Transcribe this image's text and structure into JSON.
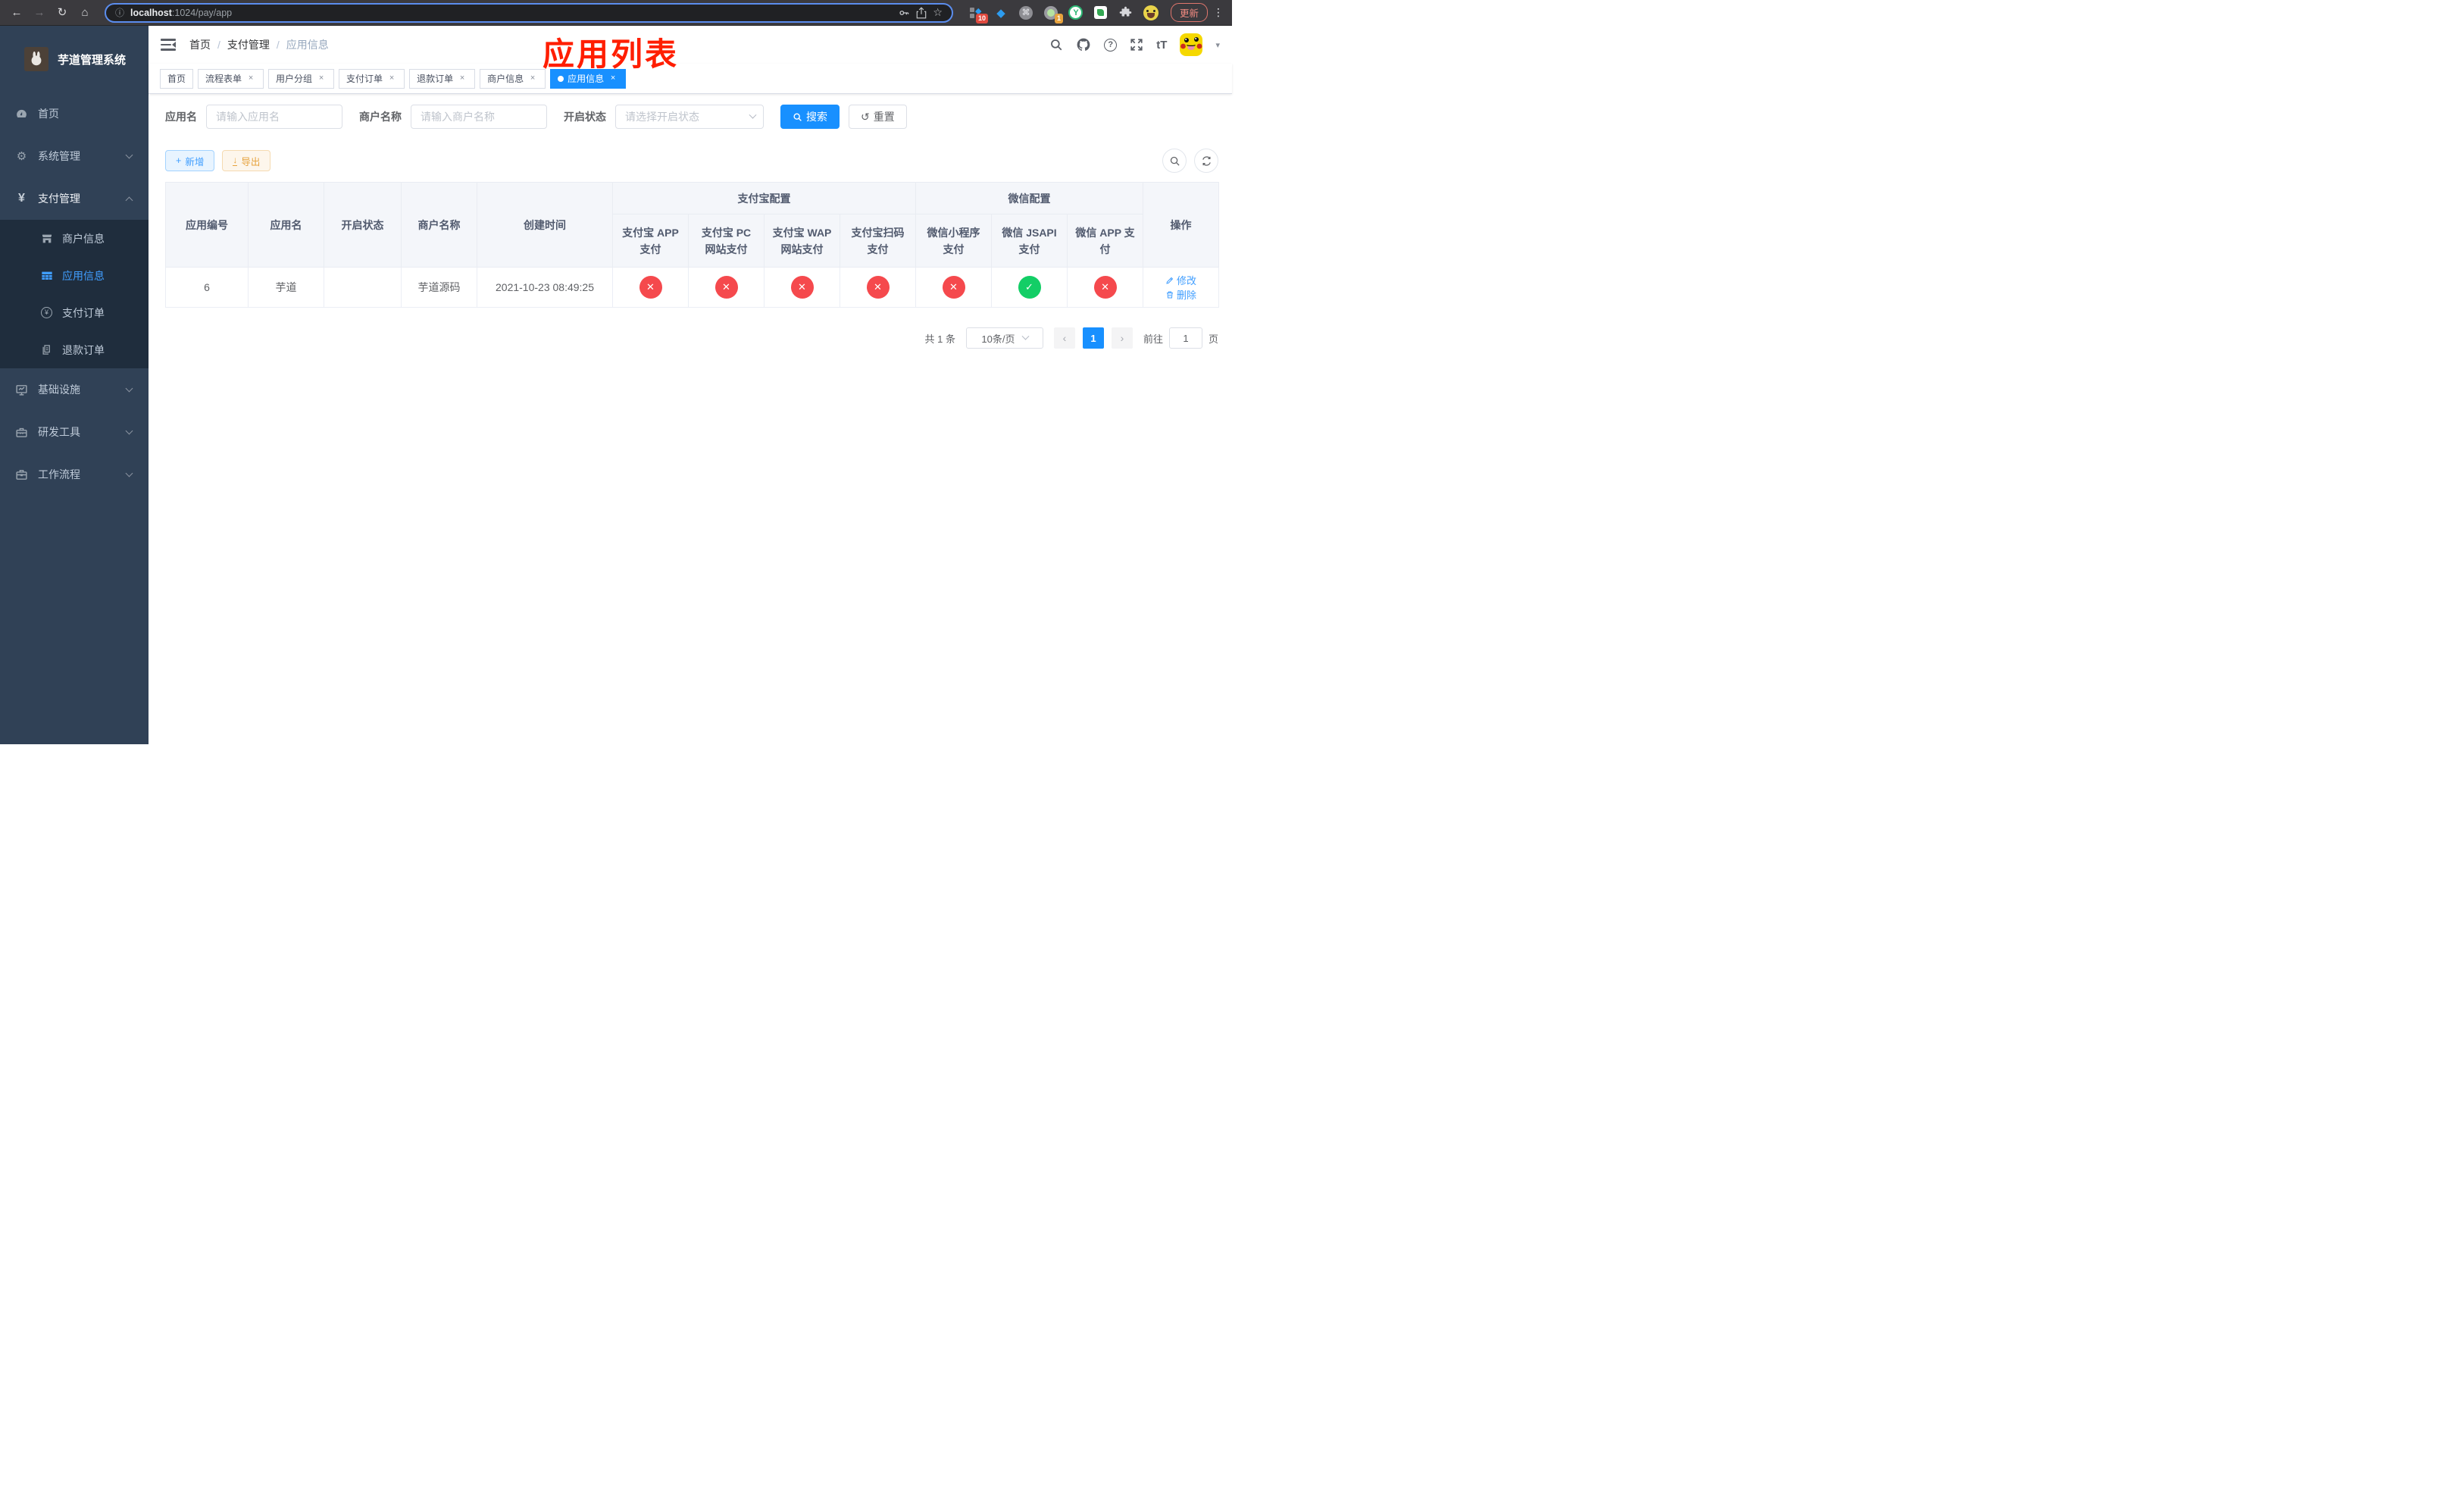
{
  "browser": {
    "url_host": "localhost",
    "url_path": ":1024/pay/app",
    "update_label": "更新",
    "ext_badge_tiles": "10",
    "ext_badge_record": "1",
    "ext_y_label": "Y"
  },
  "icons": {
    "back": "←",
    "forward": "→",
    "reload": "↻",
    "home": "⌂",
    "info": "ⓘ",
    "star": "☆",
    "command": "⌘",
    "pin": "◆",
    "diamond": "◆",
    "kebab": "⋮",
    "caret_down": "▾",
    "close": "×",
    "plus": "+",
    "download": "↓",
    "gear": "⚙",
    "yen": "¥",
    "coin_yen": "¥",
    "question": "?",
    "font_size": "tT",
    "check": "✓",
    "cross": "✕",
    "prev": "‹",
    "next": "›",
    "reset": "↺",
    "separator": "/"
  },
  "sidebar": {
    "title": "芋道管理系统",
    "menu_top": [
      {
        "label": "首页"
      },
      {
        "label": "系统管理"
      },
      {
        "label": "支付管理"
      }
    ],
    "submenu": [
      {
        "label": "商户信息"
      },
      {
        "label": "应用信息",
        "active": true
      },
      {
        "label": "支付订单"
      },
      {
        "label": "退款订单"
      }
    ],
    "menu_bottom": [
      {
        "label": "基础设施"
      },
      {
        "label": "研发工具"
      },
      {
        "label": "工作流程"
      }
    ]
  },
  "navbar": {
    "breadcrumb": [
      "首页",
      "支付管理",
      "应用信息"
    ]
  },
  "annotation": {
    "text": "应用列表"
  },
  "tabs": [
    {
      "label": "首页",
      "closable": false
    },
    {
      "label": "流程表单",
      "closable": true
    },
    {
      "label": "用户分组",
      "closable": true
    },
    {
      "label": "支付订单",
      "closable": true
    },
    {
      "label": "退款订单",
      "closable": true
    },
    {
      "label": "商户信息",
      "closable": true
    },
    {
      "label": "应用信息",
      "closable": true,
      "active": true
    }
  ],
  "filters": {
    "name_label": "应用名",
    "name_placeholder": "请输入应用名",
    "merchant_label": "商户名称",
    "merchant_placeholder": "请输入商户名称",
    "status_label": "开启状态",
    "status_placeholder": "请选择开启状态",
    "search_label": "搜索",
    "reset_label": "重置"
  },
  "toolbar": {
    "add_label": "新增",
    "export_label": "导出"
  },
  "table": {
    "fixed_columns": [
      "应用编号",
      "应用名",
      "开启状态",
      "商户名称",
      "创建时间"
    ],
    "groups": [
      {
        "label": "支付宝配置"
      },
      {
        "label": "微信配置"
      }
    ],
    "alipay_columns": [
      "支付宝 APP 支付",
      "支付宝 PC 网站支付",
      "支付宝 WAP 网站支付",
      "支付宝扫码支付"
    ],
    "wechat_columns": [
      "微信小程序支付",
      "微信 JSAPI 支付",
      "微信 APP 支付"
    ],
    "op_column": "操作",
    "row": {
      "id": "6",
      "name": "芋道",
      "enabled": true,
      "merchant": "芋道源码",
      "created_at": "2021-10-23 08:49:25",
      "channels": {
        "alipay_app": false,
        "alipay_pc": false,
        "alipay_wap": false,
        "alipay_qr": false,
        "wx_lite": false,
        "wx_jsapi": true,
        "wx_app": false
      },
      "actions": [
        {
          "label": "修改"
        },
        {
          "label": "删除"
        }
      ]
    }
  },
  "pagination": {
    "total": "共 1 条",
    "page_size": "10条/页",
    "page": "1",
    "goto_label": "前往",
    "goto_value": "1",
    "unit": "页"
  },
  "colors": {
    "accent": "#1890ff",
    "link_blue": "#409eff",
    "success": "#13ce66",
    "danger": "#f5494d",
    "warning": "#e6a23c",
    "sidebar_bg": "#304156",
    "submenu_bg": "#1f2d3d",
    "annotation_red": "#ff1e00"
  }
}
